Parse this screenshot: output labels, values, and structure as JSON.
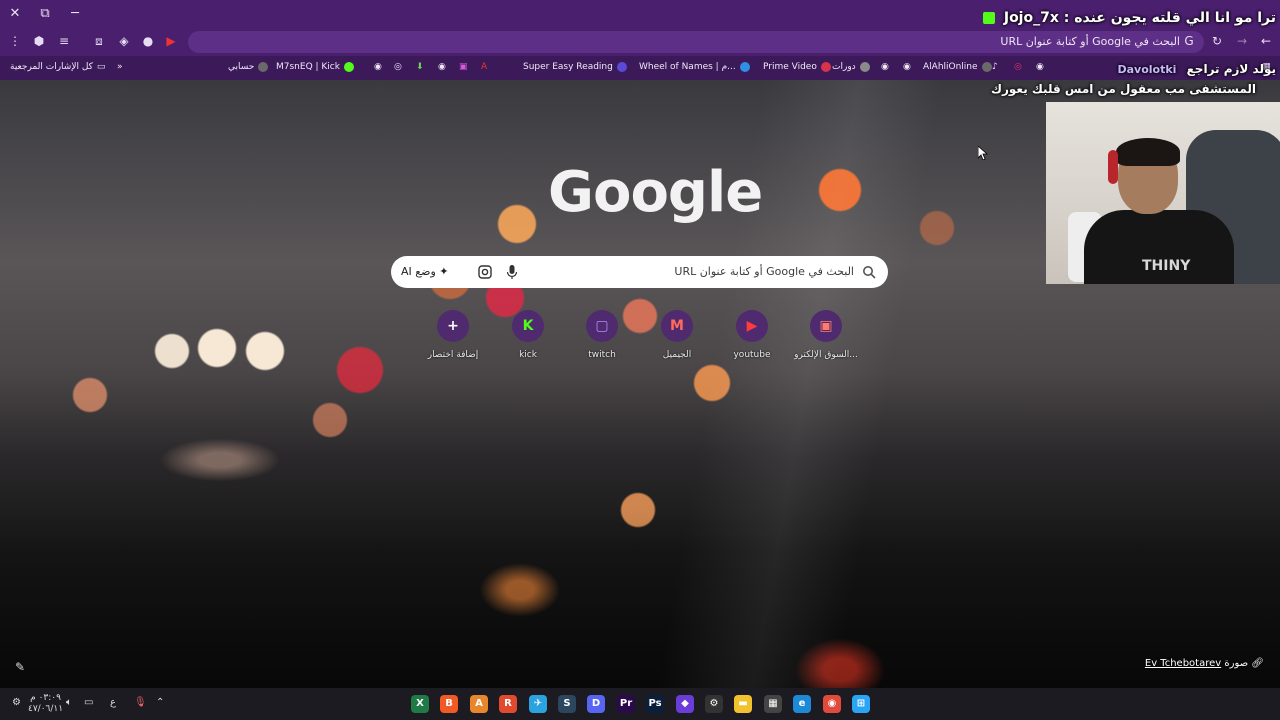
{
  "browser": {
    "omnibox_text": "البحث في Google أو كتابة عنوان URL",
    "window_controls": [
      "✕",
      "⧉",
      "─"
    ]
  },
  "bookmarks": {
    "all_bookmarks": "كل الإشارات المرجعية",
    "items": [
      {
        "label": "حسابي",
        "color": "#6a6a6a"
      },
      {
        "label": "M7snEQ | Kick",
        "color": "#53fc18"
      },
      {
        "label": "Super Easy Reading",
        "color": "#5a4bd6"
      },
      {
        "label": "Wheel of Names | م...",
        "color": "#2f8ee6"
      },
      {
        "label": "Prime Video",
        "color": "#d8334a"
      },
      {
        "label": "دورات",
        "color": "#8a8a8a"
      },
      {
        "label": "AlAhliOnline",
        "color": "#6a6a6a"
      }
    ]
  },
  "overlay": {
    "title": "ترا مو انا الي قلته يجون عنده : Jojo_7x",
    "line2": "يولد لازم تراجع",
    "line3": "المستشفى مب معقول من امس قلبك يعورك",
    "channel_tag": "Davolotki"
  },
  "newtab": {
    "logo": "Google",
    "search_placeholder": "البحث في Google أو كتابة عنوان URL",
    "ai_mode_label": "وضع AI",
    "shortcuts": [
      {
        "label": "السوق الإلكترو...",
        "glyph": "▣",
        "color": "#c24a3a"
      },
      {
        "label": "youtube",
        "glyph": "▶",
        "color": "#e32b2b"
      },
      {
        "label": "الجيميل",
        "glyph": "M",
        "color": "#d44638"
      },
      {
        "label": "twitch",
        "glyph": "▢",
        "color": "#9146ff"
      },
      {
        "label": "kick",
        "glyph": "K",
        "color": "#53fc18"
      },
      {
        "label": "إضافة اختصار",
        "glyph": "+",
        "color": "#4f2a6e"
      }
    ],
    "attribution_prefix": "صورة",
    "attribution_link": "Ev Tchebotarev"
  },
  "taskbar": {
    "time": "٠٣:٠٩ م",
    "date": "٤٧/٠٦/١١",
    "lang": "ع",
    "apps": [
      {
        "name": "excel",
        "glyph": "X",
        "color": "#1f7a46"
      },
      {
        "name": "brave",
        "glyph": "B",
        "color": "#f15a24"
      },
      {
        "name": "alpha",
        "glyph": "A",
        "color": "#e8862b"
      },
      {
        "name": "mozilla",
        "glyph": "R",
        "color": "#e14a2d"
      },
      {
        "name": "telegram",
        "glyph": "✈",
        "color": "#2aa3e0"
      },
      {
        "name": "steam",
        "glyph": "S",
        "color": "#2a475e"
      },
      {
        "name": "discord",
        "glyph": "D",
        "color": "#5865f2"
      },
      {
        "name": "premiere",
        "glyph": "Pr",
        "color": "#2a0a4a"
      },
      {
        "name": "photoshop",
        "glyph": "Ps",
        "color": "#0b1f3b"
      },
      {
        "name": "clipchamp",
        "glyph": "◆",
        "color": "#6a3cd8"
      },
      {
        "name": "steam-alt",
        "glyph": "⚙",
        "color": "#333"
      },
      {
        "name": "explorer",
        "glyph": "▬",
        "color": "#f2c12e"
      },
      {
        "name": "store",
        "glyph": "▦",
        "color": "#444"
      },
      {
        "name": "edge",
        "glyph": "e",
        "color": "#1c8ad6"
      },
      {
        "name": "chrome",
        "glyph": "◉",
        "color": "#e04b3b"
      },
      {
        "name": "start",
        "glyph": "⊞",
        "color": "#2aa4f4"
      }
    ]
  }
}
